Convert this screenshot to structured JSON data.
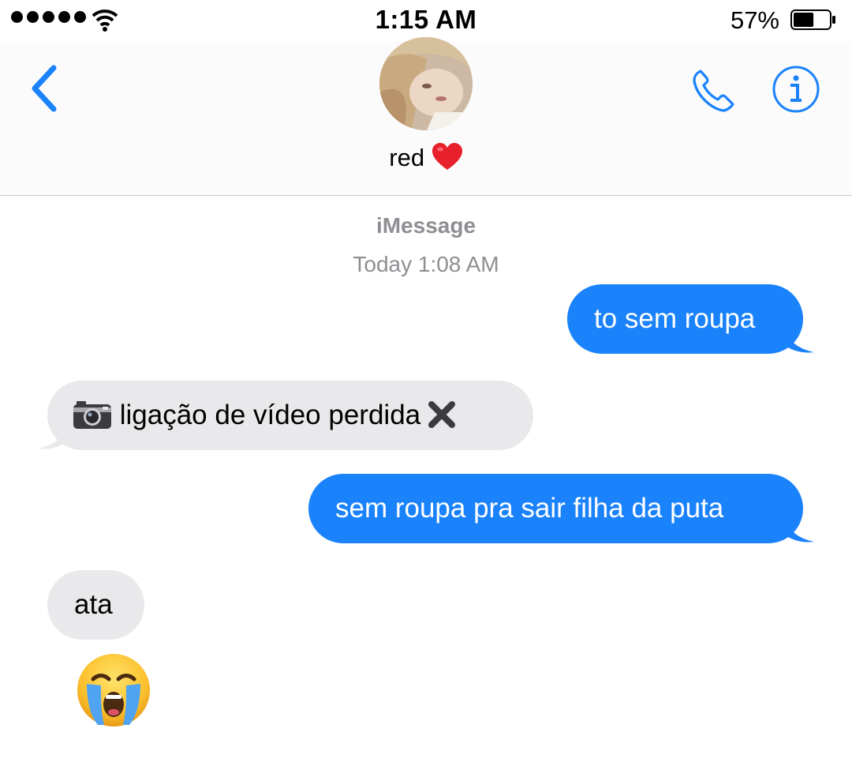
{
  "status_bar": {
    "time": "1:15 AM",
    "battery_percent": "57%",
    "battery_level": 0.57,
    "signal_dots": 5
  },
  "header": {
    "back_icon": "chevron-left-icon",
    "contact_name": "red",
    "contact_emoji": "❤️",
    "call_icon": "phone-icon",
    "info_icon": "info-icon",
    "accent_color": "#1a82fb"
  },
  "conversation": {
    "service": "iMessage",
    "timestamp": "Today 1:08 AM",
    "messages": [
      {
        "direction": "sent",
        "text": "to sem roupa"
      },
      {
        "direction": "received",
        "prefix_icon": "camera-icon",
        "text": "ligação de vídeo perdida",
        "suffix_icon": "cross-mark-icon"
      },
      {
        "direction": "sent",
        "text": "sem roupa pra sair filha da puta"
      },
      {
        "direction": "received",
        "text": "ata"
      },
      {
        "direction": "received",
        "emoji": "crying-face-emoji"
      }
    ]
  },
  "colors": {
    "sent_bubble": "#1a82fb",
    "received_bubble": "#e9e9eb",
    "meta_text": "#8e8e93"
  }
}
